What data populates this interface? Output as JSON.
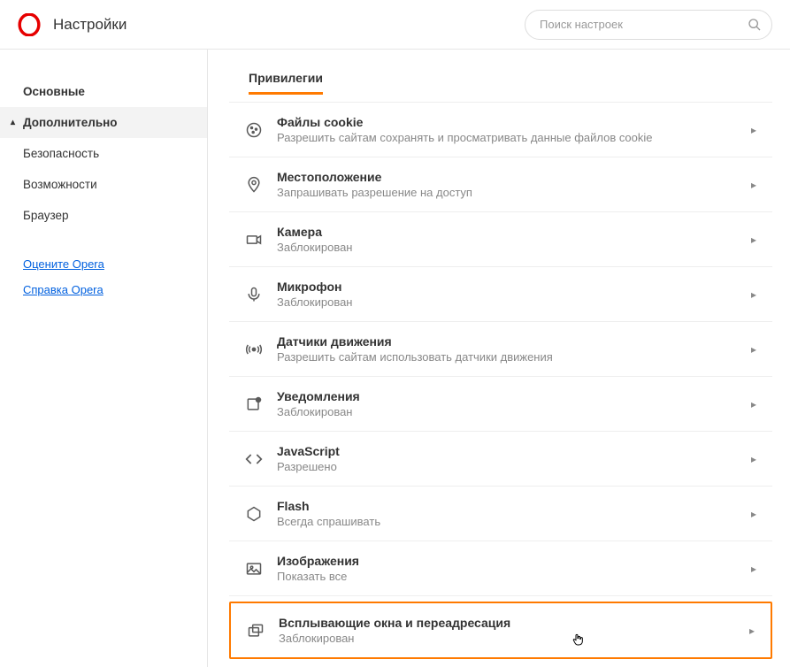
{
  "header": {
    "title": "Настройки",
    "search_placeholder": "Поиск настроек"
  },
  "sidebar": {
    "items": [
      {
        "label": "Основные"
      },
      {
        "label": "Дополнительно"
      },
      {
        "label": "Безопасность"
      },
      {
        "label": "Возможности"
      },
      {
        "label": "Браузер"
      }
    ],
    "links": [
      {
        "label": "Оцените Opera"
      },
      {
        "label": "Справка Opera"
      }
    ]
  },
  "section": {
    "title": "Привилегии"
  },
  "privileges": [
    {
      "title": "Файлы cookie",
      "sub": "Разрешить сайтам сохранять и просматривать данные файлов cookie"
    },
    {
      "title": "Местоположение",
      "sub": "Запрашивать разрешение на доступ"
    },
    {
      "title": "Камера",
      "sub": "Заблокирован"
    },
    {
      "title": "Микрофон",
      "sub": "Заблокирован"
    },
    {
      "title": "Датчики движения",
      "sub": "Разрешить сайтам использовать датчики движения"
    },
    {
      "title": "Уведомления",
      "sub": "Заблокирован"
    },
    {
      "title": "JavaScript",
      "sub": "Разрешено"
    },
    {
      "title": "Flash",
      "sub": "Всегда спрашивать"
    },
    {
      "title": "Изображения",
      "sub": "Показать все"
    },
    {
      "title": "Всплывающие окна и переадресация",
      "sub": "Заблокирован"
    }
  ]
}
